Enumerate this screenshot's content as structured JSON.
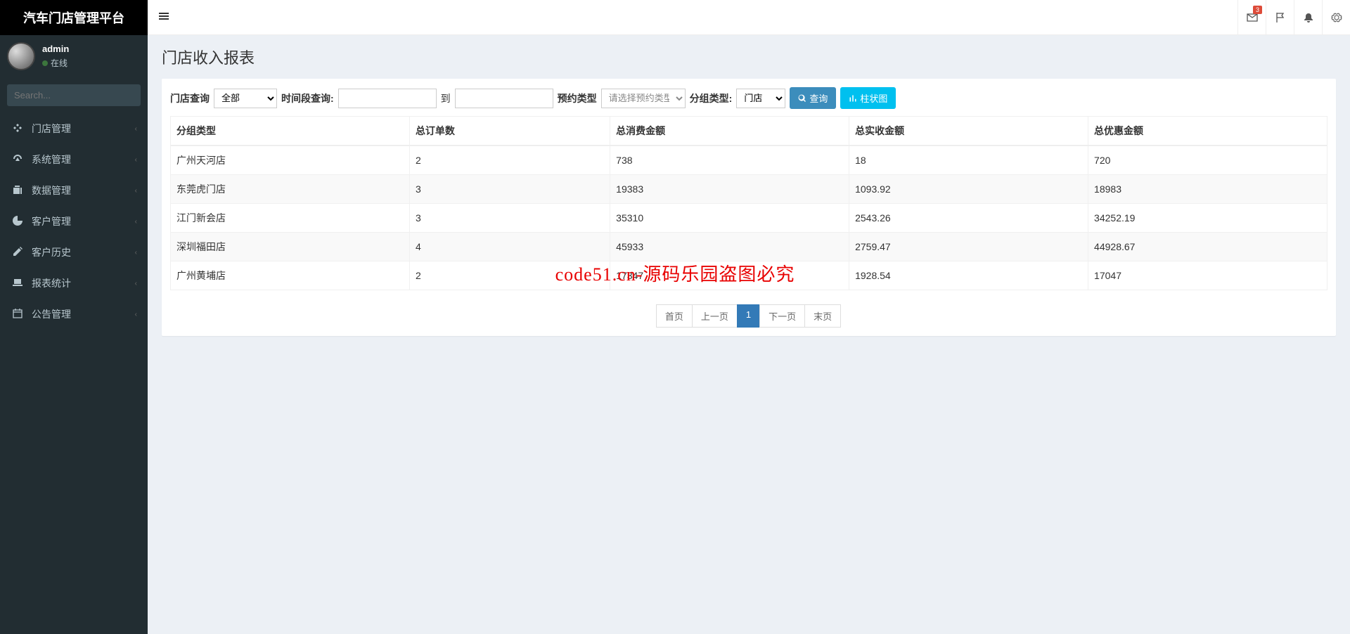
{
  "app_title": "汽车门店管理平台",
  "user": {
    "name": "admin",
    "status": "在线"
  },
  "search_placeholder": "Search...",
  "menu": [
    {
      "label": "门店管理",
      "icon": "joomla"
    },
    {
      "label": "系统管理",
      "icon": "dashboard"
    },
    {
      "label": "数据管理",
      "icon": "copy"
    },
    {
      "label": "客户管理",
      "icon": "pie"
    },
    {
      "label": "客户历史",
      "icon": "edit"
    },
    {
      "label": "报表统计",
      "icon": "laptop"
    },
    {
      "label": "公告管理",
      "icon": "calendar"
    }
  ],
  "notif_badge": "3",
  "page_title": "门店收入报表",
  "filters": {
    "shop_label": "门店查询",
    "shop_value": "全部",
    "time_label": "时间段查询:",
    "to_label": "到",
    "type_label": "预约类型",
    "type_placeholder": "请选择预约类型",
    "group_label": "分组类型:",
    "group_value": "门店",
    "query_btn": "查询",
    "chart_btn": "柱状图"
  },
  "table": {
    "headers": [
      "分组类型",
      "总订单数",
      "总消费金额",
      "总实收金额",
      "总优惠金额"
    ],
    "rows": [
      [
        "广州天河店",
        "2",
        "738",
        "18",
        "720"
      ],
      [
        "东莞虎门店",
        "3",
        "19383",
        "1093.92",
        "18983"
      ],
      [
        "江门新会店",
        "3",
        "35310",
        "2543.26",
        "34252.19"
      ],
      [
        "深圳福田店",
        "4",
        "45933",
        "2759.47",
        "44928.67"
      ],
      [
        "广州黄埔店",
        "2",
        "17347",
        "1928.54",
        "17047"
      ]
    ]
  },
  "pagination": {
    "first": "首页",
    "prev": "上一页",
    "current": "1",
    "next": "下一页",
    "last": "末页"
  },
  "watermark": "code51.cn-源码乐园盗图必究"
}
